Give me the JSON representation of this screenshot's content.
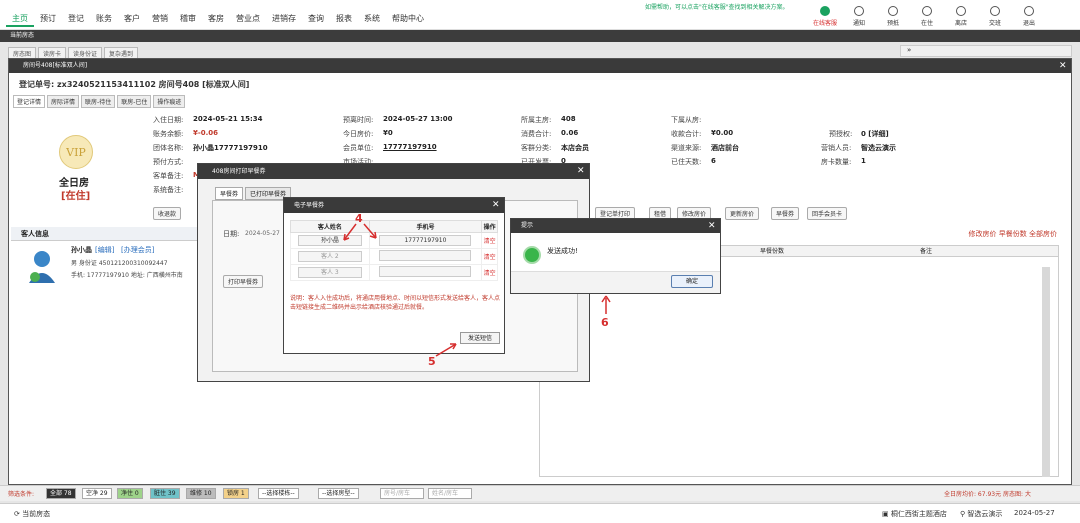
{
  "top": {
    "menu": [
      "主页",
      "预订",
      "登记",
      "账务",
      "客户",
      "营销",
      "稽审",
      "客房",
      "营业点",
      "进销存",
      "查询",
      "报表",
      "系统",
      "帮助中心"
    ],
    "active_menu": "主页",
    "help_line": "如需帮助，可以点击\"在线客服\"查找到相关解决方案。",
    "quick": [
      "在线客服",
      "通知",
      "预抵",
      "在住",
      "离店",
      "交班",
      "退出"
    ]
  },
  "section_bar": "当前房态",
  "bg_tabs": [
    "房态图",
    "读房卡",
    "读身份证",
    "复杂遇到"
  ],
  "room_window": {
    "title": "房间号408[标准双人间]",
    "reg_label": "登记单号:",
    "reg_value": "zx3240521153411102 房间号408 [标准双人间]",
    "tabs": [
      "登记详情",
      "房际详情",
      "联房-待住",
      "联房-已住",
      "操作痕迹"
    ],
    "vip": "VIP",
    "room_kind": "全日房",
    "status": "[在住]",
    "fields": {
      "checkin_label": "入住日期:",
      "checkin": "2024-05-21 15:34",
      "balance_label": "账务余额:",
      "balance": "¥-0.06",
      "group_label": "团体名称:",
      "group": "孙小晶17777197910",
      "prepay_label": "预付方式:",
      "remark_label": "客单备注:",
      "remark": "M",
      "sys_remark_label": "系统备注:",
      "depart_label": "预离时间:",
      "depart": "2024-05-27 13:00",
      "today_price_label": "今日房价:",
      "today_price": "¥0",
      "member_label": "会员单位:",
      "member": "17777197910",
      "market_label": "市场活动:",
      "main_room_label": "所属主房:",
      "main_room": "408",
      "consume_label": "消费合计:",
      "consume": "0.06",
      "guest_type_label": "客群分类:",
      "guest_type": "本店会员",
      "invoiced_label": "已开发票:",
      "invoiced": "0",
      "sub_room_label": "下属从房:",
      "payment_label": "收款合计:",
      "payment": "¥0.00",
      "channel_label": "渠道来源:",
      "channel": "酒店前台",
      "days_label": "已住天数:",
      "days": "6",
      "auth_label": "预授权:",
      "auth": "0 [详细]",
      "sales_label": "营销人员:",
      "sales": "智选云演示",
      "card_label": "房卡数量:",
      "card": "1"
    },
    "collect_button": "收退款",
    "action_buttons": [
      "登记单打印",
      "租借",
      "修改房价",
      "更新房价",
      "早餐券",
      "回手会员卡"
    ],
    "guest_info_header": "客人信息",
    "guest": {
      "name": "孙小晶",
      "edit": "[编辑]",
      "join": "[办理会员]",
      "id_line": "男 身份证 450121200310092447",
      "phone_line": "手机: 17777197910 地址: 广西横州市南"
    },
    "rate_links": "修改房价  早餐份数  全部房价",
    "table_headers": [
      "早餐份数",
      "备注"
    ]
  },
  "breakfast_dialog": {
    "title": "408房间打印早餐券",
    "tabs": [
      "早餐券",
      "已打印早餐券"
    ],
    "date_label": "日期:",
    "date_value": "2024-05-27",
    "print_button": "打印早餐券"
  },
  "ebreakfast_dialog": {
    "title": "电子早餐券",
    "headers": [
      "客人姓名",
      "手机号",
      "操作"
    ],
    "rows": [
      {
        "name": "孙小晶",
        "phone": "17777197910",
        "op": "清空"
      },
      {
        "name": "客人 2",
        "phone": "",
        "op": "清空"
      },
      {
        "name": "客人 3",
        "phone": "",
        "op": "清空"
      }
    ],
    "note": "说明：客人入住成功后，将通店用餐地点、时间以短信形式发送给客人，客人点击短链接生成二维码并出示给酒店核验通过后就餐。",
    "send_button": "发送短信"
  },
  "prompt_dialog": {
    "title": "提示",
    "message": "发送成功!",
    "ok": "确定"
  },
  "annotations": [
    "4",
    "5",
    "6"
  ],
  "filter_bar": {
    "label": "筛选条件:",
    "chips": [
      "全部 78",
      "空净 29",
      "净住 0",
      "脏住 39",
      "维修 10",
      "锁房 1"
    ],
    "selects": [
      "--选择楼栋--",
      "--选择房型--"
    ],
    "placeholders": [
      "房号/房车",
      "姓名/房车"
    ],
    "right_text": "全日房均价: 67.93元  房态图: 大"
  },
  "status_bar": {
    "left": "当前房态",
    "hotel": "桐仁西街主题酒店",
    "user": "智选云演示",
    "date": "2024-05-27"
  }
}
